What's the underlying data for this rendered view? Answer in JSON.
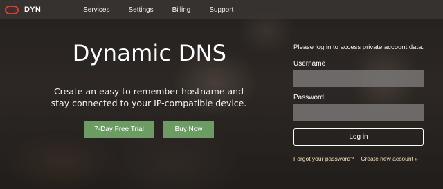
{
  "brand": {
    "name": "DYN",
    "logo_icon": "oracle-logo-icon",
    "logo_color": "#e03a2f"
  },
  "nav": {
    "items": [
      {
        "label": "Services"
      },
      {
        "label": "Settings"
      },
      {
        "label": "Billing"
      },
      {
        "label": "Support"
      }
    ]
  },
  "hero": {
    "title": "Dynamic DNS",
    "subtitle": "Create an easy to remember hostname and stay connected to your IP-compatible device.",
    "trial_button": "7-Day Free Trial",
    "buy_button": "Buy Now",
    "button_color": "#6c9b64"
  },
  "login": {
    "intro": "Please log in to access private account data.",
    "username_label": "Username",
    "username_value": "",
    "password_label": "Password",
    "password_value": "",
    "submit_label": "Log in",
    "forgot_link": "Forgot your password?",
    "create_link": "Create new account »"
  }
}
